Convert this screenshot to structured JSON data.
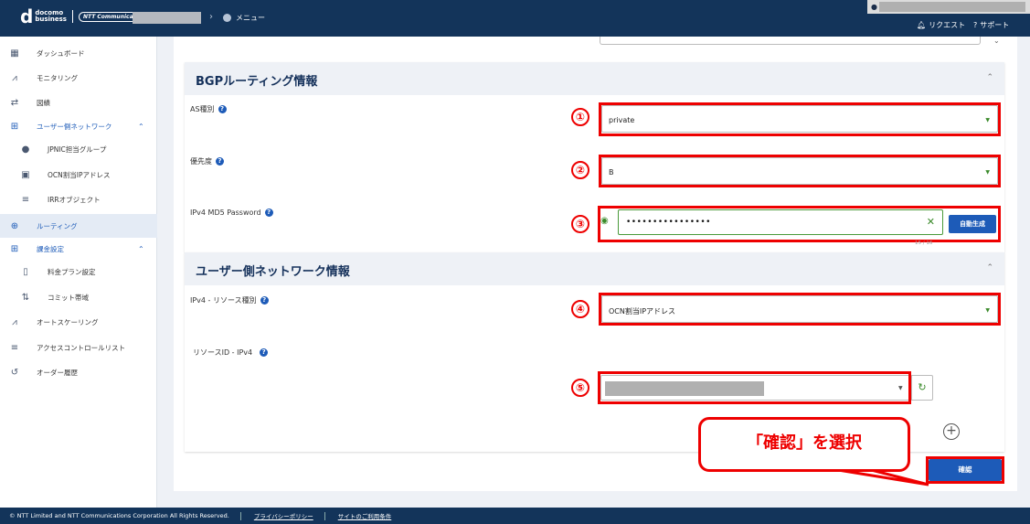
{
  "header": {
    "logo_mark": "d",
    "logo_line1": "docomo",
    "logo_line2": "business",
    "logo_ntt": "NTT Communications",
    "breadcrumb_menu": "メニュー",
    "request_label": "リクエスト",
    "support_label": "サポート"
  },
  "sidebar": {
    "items": [
      {
        "label": "ダッシュボード",
        "icon": "dashboard-icon"
      },
      {
        "label": "モニタリング",
        "icon": "chart-line-icon"
      },
      {
        "label": "図績",
        "icon": "diagram-icon"
      },
      {
        "label": "ユーザー側ネットワーク",
        "icon": "network-icon"
      },
      {
        "label": "JPNIC担当グループ",
        "icon": "person-icon"
      },
      {
        "label": "OCN割当IPアドレス",
        "icon": "monitor-icon"
      },
      {
        "label": "IRRオブジェクト",
        "icon": "database-icon"
      },
      {
        "label": "ルーティング",
        "icon": "routing-icon"
      },
      {
        "label": "課金設定",
        "icon": "network-icon"
      },
      {
        "label": "料金プラン設定",
        "icon": "notebook-icon"
      },
      {
        "label": "コミット帯域",
        "icon": "commit-icon"
      },
      {
        "label": "オートスケーリング",
        "icon": "autoscale-icon"
      },
      {
        "label": "アクセスコントロールリスト",
        "icon": "list-icon"
      },
      {
        "label": "オーダー履歴",
        "icon": "history-icon"
      }
    ]
  },
  "bgp": {
    "title": "BGPルーティング情報",
    "as_label": "AS種別",
    "as_value": "private",
    "priority_label": "優先度",
    "priority_value": "B",
    "md5_label": "IPv4 MD5 Password",
    "md5_value": "••••••••••••••••",
    "auto_button": "自動生成",
    "counter": "15 / 16"
  },
  "usernet": {
    "title": "ユーザー側ネットワーク情報",
    "resource_type_label": "IPv4 - リソース種別",
    "resource_type_value": "OCN割当IPアドレス",
    "resource_id_label": "リソースID - IPv4"
  },
  "annotations": {
    "n1": "①",
    "n2": "②",
    "n3": "③",
    "n4": "④",
    "n5": "⑤",
    "callout": "「確認」を選択"
  },
  "confirm_button": "確認",
  "footer": {
    "copyright": "© NTT Limited and NTT Communications Corporation All Rights Reserved.",
    "privacy": "プライバシーポリシー",
    "terms": "サイトのご利用条件"
  },
  "colors": {
    "header_bg": "#13345a",
    "accent_blue": "#1d5bb8",
    "annotation_red": "#e00000",
    "valid_green": "#3a8a2a"
  }
}
